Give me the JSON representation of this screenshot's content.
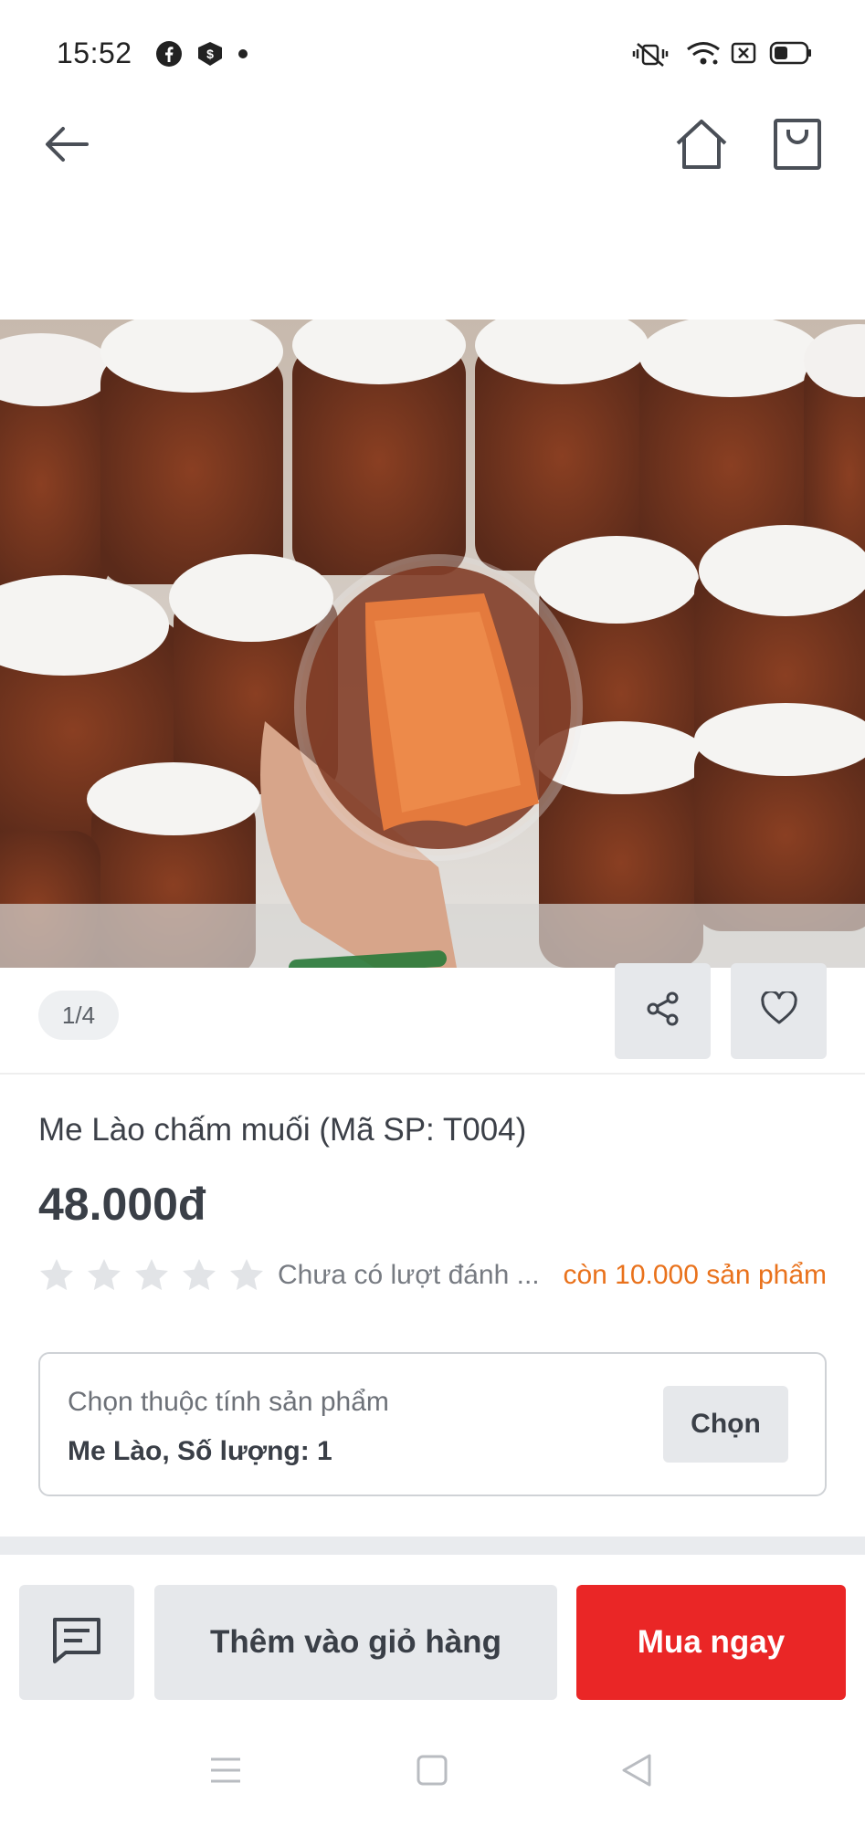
{
  "status_bar": {
    "time": "15:52",
    "left_icons": [
      "facebook-icon",
      "messenger-icon",
      "dot-icon"
    ],
    "right_icons": [
      "vibrate-icon",
      "wifi-icon",
      "sim-icon",
      "battery-icon"
    ]
  },
  "top_nav": {
    "icons": [
      "back-arrow-icon",
      "home-icon",
      "shopping-bag-icon"
    ]
  },
  "gallery": {
    "page_indicator": "1/4",
    "actions": [
      "share-icon",
      "heart-icon"
    ]
  },
  "product": {
    "title": "Me Lào chấm muối (Mã SP: T004)",
    "price": "48.000đ",
    "rating_text": "Chưa có lượt đánh ...",
    "stars_total": 5,
    "stars_filled": 0,
    "stock_text": "còn 10.000 sản phẩm"
  },
  "attributes": {
    "label": "Chọn thuộc tính sản phẩm",
    "value": "Me Lào, Số lượng: 1",
    "choose_label": "Chọn"
  },
  "actions": {
    "add_to_cart_label": "Thêm vào giỏ hàng",
    "buy_now_label": "Mua ngay",
    "buy_color": "#ea2626"
  },
  "colors": {
    "stock_accent": "#e9721c",
    "button_bg": "#e6e8eb",
    "text_dark": "#3a3f47"
  }
}
